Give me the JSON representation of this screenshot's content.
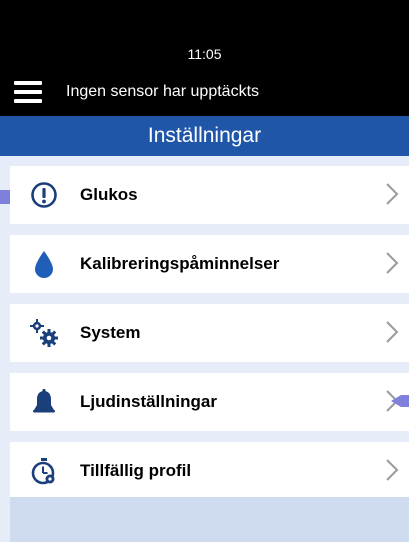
{
  "status_bar": {
    "time": "11:05"
  },
  "topbar": {
    "message": "Ingen sensor har upptäckts",
    "menu_icon": "hamburger-icon"
  },
  "page": {
    "title": "Inställningar"
  },
  "menu": {
    "items": [
      {
        "label": "Glukos",
        "icon": "alert-circle-icon"
      },
      {
        "label": "Kalibreringspåminnelser",
        "icon": "drop-icon"
      },
      {
        "label": "System",
        "icon": "gears-icon"
      },
      {
        "label": "Ljudinställningar",
        "icon": "bell-icon"
      },
      {
        "label": "Tillfällig profil",
        "icon": "stopwatch-icon"
      }
    ]
  },
  "colors": {
    "header_black": "#000000",
    "title_blue": "#1f56a8",
    "icon_navy": "#1b3f7a",
    "background": "#e6edf8",
    "pointer_purple": "#7f7fdc"
  }
}
